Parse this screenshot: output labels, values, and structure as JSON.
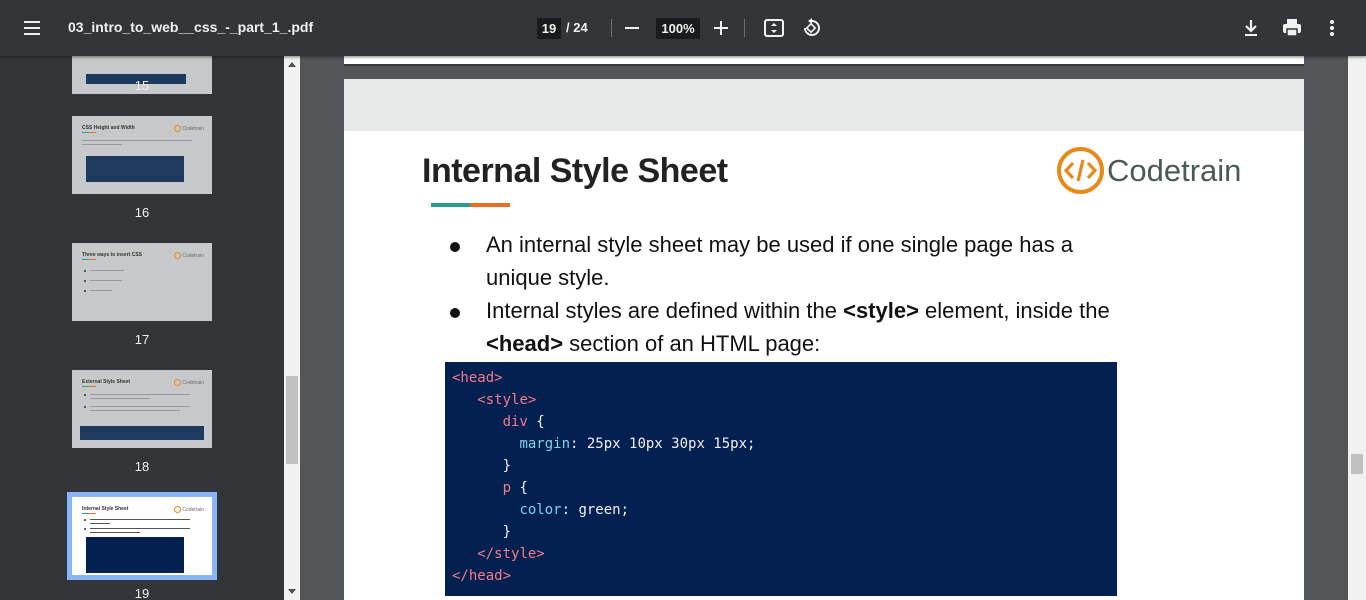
{
  "toolbar": {
    "title": "03_intro_to_web__css_-_part_1_.pdf",
    "current_page": "19",
    "total_pages": "/ 24",
    "zoom": "100%"
  },
  "thumbnails": [
    {
      "label": "15",
      "title": "",
      "logo": ""
    },
    {
      "label": "16",
      "title": "CSS Height and Width",
      "logo": "Codetrain"
    },
    {
      "label": "17",
      "title": "Three ways to insert CSS",
      "logo": "Codetrain"
    },
    {
      "label": "18",
      "title": "External Style Sheet",
      "logo": "Codetrain"
    },
    {
      "label": "19",
      "title": "Internal Style Sheet",
      "logo": "Codetrain"
    }
  ],
  "slide": {
    "title": "Internal Style Sheet",
    "logo_text": "Codetrain",
    "logo_glyph": "</>",
    "bullets": [
      {
        "pre": "An internal style sheet may be used if one single page has a unique style.",
        "tag1": "",
        "mid": "",
        "tag2": "",
        "post": ""
      },
      {
        "pre": "Internal styles are defined within the ",
        "tag1": "<style>",
        "mid": " element, inside the ",
        "tag2": "<head>",
        "post": " section of an HTML page:"
      }
    ],
    "code": [
      {
        "indent": "",
        "parts": [
          {
            "cls": "c-tag",
            "text": "<head>"
          }
        ]
      },
      {
        "indent": "   ",
        "parts": [
          {
            "cls": "c-tag",
            "text": "<style>"
          }
        ]
      },
      {
        "indent": "      ",
        "parts": [
          {
            "cls": "c-sel",
            "text": "div"
          },
          {
            "cls": "c-txt",
            "text": " {"
          }
        ]
      },
      {
        "indent": "        ",
        "parts": [
          {
            "cls": "c-prop",
            "text": "margin"
          },
          {
            "cls": "c-txt",
            "text": ": 25px 10px 30px 15px;"
          }
        ]
      },
      {
        "indent": "      ",
        "parts": [
          {
            "cls": "c-txt",
            "text": "}"
          }
        ]
      },
      {
        "indent": "      ",
        "parts": [
          {
            "cls": "c-sel",
            "text": "p"
          },
          {
            "cls": "c-txt",
            "text": " {"
          }
        ]
      },
      {
        "indent": "        ",
        "parts": [
          {
            "cls": "c-prop",
            "text": "color"
          },
          {
            "cls": "c-txt",
            "text": ": green;"
          }
        ]
      },
      {
        "indent": "      ",
        "parts": [
          {
            "cls": "c-txt",
            "text": "}"
          }
        ]
      },
      {
        "indent": "   ",
        "parts": [
          {
            "cls": "c-tag",
            "text": "</style>"
          }
        ]
      },
      {
        "indent": "",
        "parts": [
          {
            "cls": "c-tag",
            "text": "</head>"
          }
        ]
      }
    ]
  },
  "icons": {
    "menu": "menu-icon",
    "download": "download-icon",
    "print": "print-icon",
    "more": "more-vert-icon",
    "fit": "fit-page-icon",
    "rotate": "rotate-icon"
  },
  "colors": {
    "toolbar_bg": "#323639",
    "viewer_bg": "#525659",
    "code_bg": "#032050",
    "accent_teal": "#2a9d8f",
    "accent_orange": "#e76f24",
    "selection": "#8ab4f8"
  }
}
